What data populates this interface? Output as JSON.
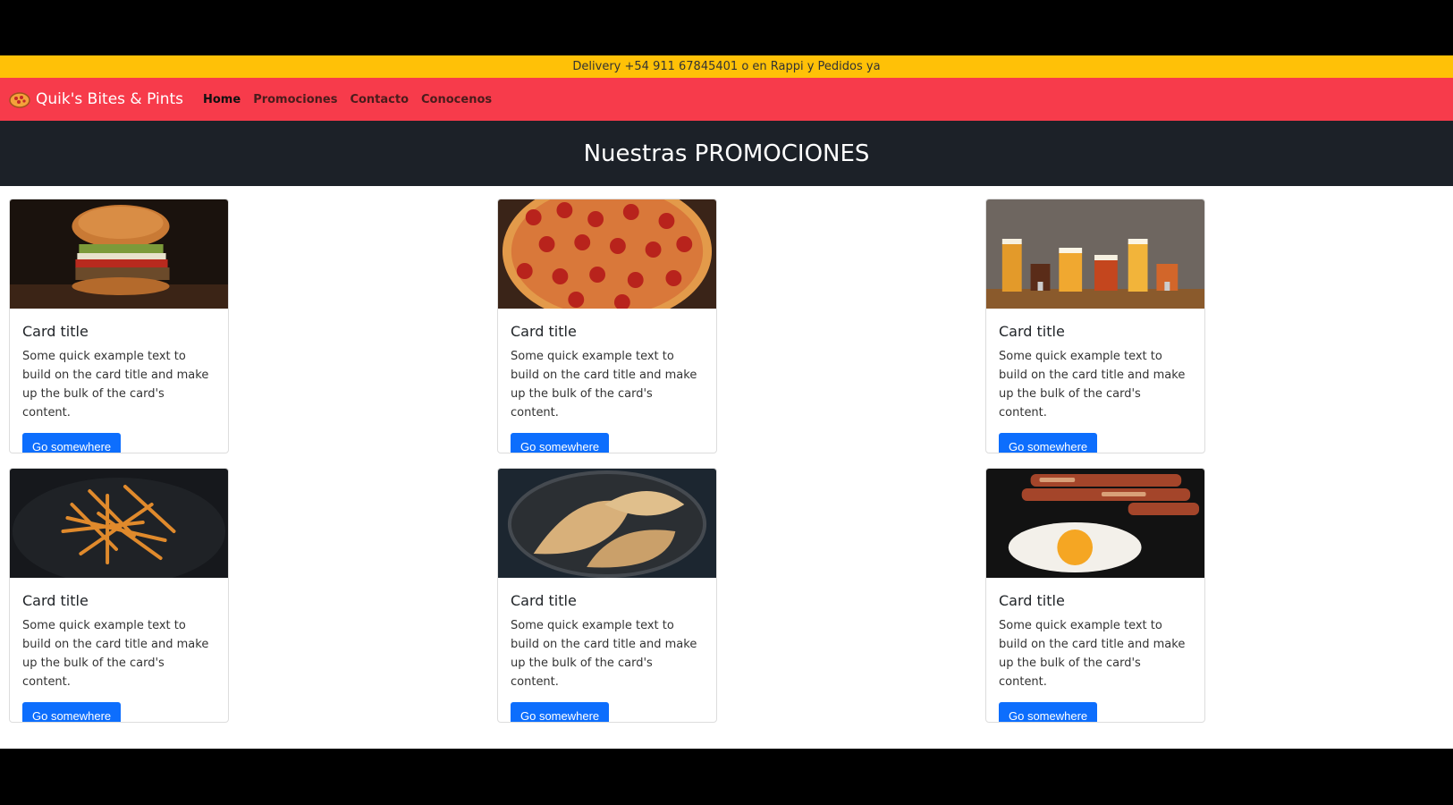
{
  "topbar": {
    "text": "Delivery +54 911 67845401 o en Rappi y Pedidos ya"
  },
  "navbar": {
    "brand": "Quik's Bites & Pints",
    "links": [
      "Home",
      "Promociones",
      "Contacto",
      "Conocenos"
    ]
  },
  "hero": {
    "title": "Nuestras PROMOCIONES"
  },
  "cards": [
    {
      "image": "burger-photo",
      "title": "Card title",
      "text": "Some quick example text to build on the card title and make up the bulk of the card's content.",
      "button": "Go somewhere"
    },
    {
      "image": "pizza-photo",
      "title": "Card title",
      "text": "Some quick example text to build on the card title and make up the bulk of the card's content.",
      "button": "Go somewhere"
    },
    {
      "image": "beers-photo",
      "title": "Card title",
      "text": "Some quick example text to build on the card title and make up the bulk of the card's content.",
      "button": "Go somewhere"
    },
    {
      "image": "fries-photo",
      "title": "Card title",
      "text": "Some quick example text to build on the card title and make up the bulk of the card's content.",
      "button": "Go somewhere"
    },
    {
      "image": "empanadas-photo",
      "title": "Card title",
      "text": "Some quick example text to build on the card title and make up the bulk of the card's content.",
      "button": "Go somewhere"
    },
    {
      "image": "bacon-egg-photo",
      "title": "Card title",
      "text": "Some quick example text to build on the card title and make up the bulk of the card's content.",
      "button": "Go somewhere"
    }
  ],
  "colors": {
    "topbar": "#ffc107",
    "navbar": "#f73b4b",
    "hero": "#1c2128",
    "button": "#0d6efd"
  }
}
